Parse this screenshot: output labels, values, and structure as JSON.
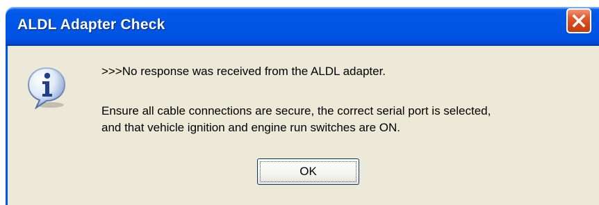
{
  "window": {
    "title": "ALDL Adapter Check",
    "close_icon": "close-icon"
  },
  "dialog": {
    "icon": "information-icon",
    "message_line1": ">>>No response was received from the ALDL adapter.",
    "message_line2": "Ensure all cable connections are secure, the correct serial port is selected,",
    "message_line3": "and that vehicle ignition and engine run switches are ON.",
    "ok_label": "OK"
  }
}
